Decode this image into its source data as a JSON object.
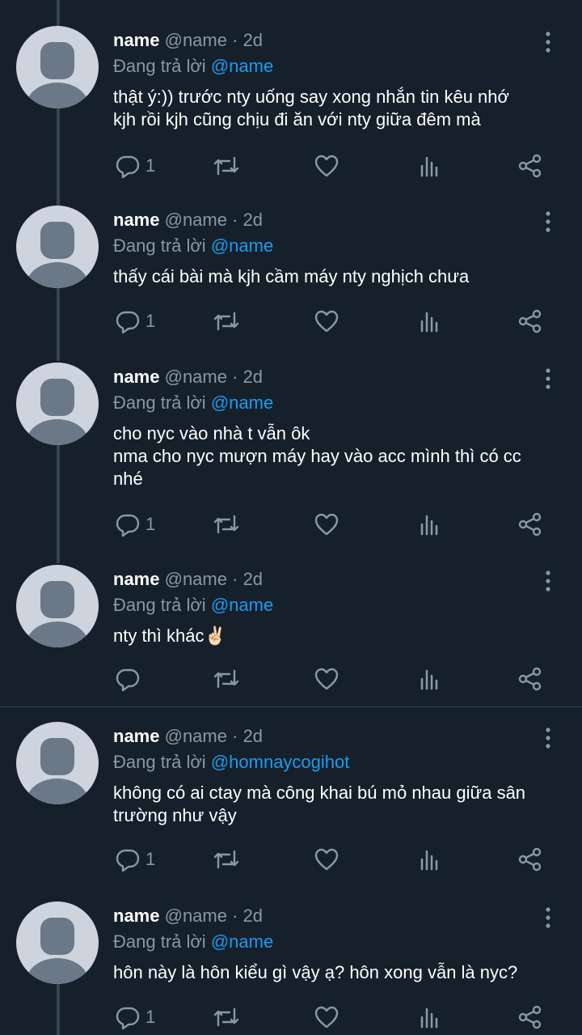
{
  "tweets": [
    {
      "name": "name",
      "handle": "@name",
      "sep": "·",
      "time": "2d",
      "reply_prefix": "Đang trả lời",
      "reply_to": "@name",
      "lines": [
        "thật ý:)) trước nty uống say xong nhắn tin kêu nhớ",
        "kjh rồi kjh cũng chịu đi ăn với nty giữa đêm mà"
      ],
      "reply_count": "1"
    },
    {
      "name": "name",
      "handle": "@name",
      "sep": "·",
      "time": "2d",
      "reply_prefix": "Đang trả lời",
      "reply_to": "@name",
      "lines": [
        "thấy cái bài mà kjh cầm máy nty nghịch chưa"
      ],
      "reply_count": "1"
    },
    {
      "name": "name",
      "handle": "@name",
      "sep": "·",
      "time": "2d",
      "reply_prefix": "Đang trả lời",
      "reply_to": "@name",
      "lines": [
        "cho nyc vào nhà t vẫn ôk",
        "nma cho nyc mượn máy hay vào acc mình thì có cc",
        "nhé"
      ],
      "reply_count": "1"
    },
    {
      "name": "name",
      "handle": "@name",
      "sep": "·",
      "time": "2d",
      "reply_prefix": "Đang trả lời",
      "reply_to": "@name",
      "lines": [
        "nty thì khác✌🏻"
      ],
      "reply_count": ""
    },
    {
      "name": "name",
      "handle": "@name",
      "sep": "·",
      "time": "2d",
      "reply_prefix": "Đang trả lời",
      "reply_to": "@homnaycogihot",
      "lines": [
        "không có ai ctay mà công khai bú mỏ nhau giữa sân",
        "trường như vậy"
      ],
      "reply_count": "1"
    },
    {
      "name": "name",
      "handle": "@name",
      "sep": "·",
      "time": "2d",
      "reply_prefix": "Đang trả lời",
      "reply_to": "@name",
      "lines": [
        "hôn này là hôn kiểu gì vậy ạ? hôn xong vẫn là nyc?"
      ],
      "reply_count": "1"
    }
  ],
  "icons": {
    "reply": "reply-icon",
    "retweet": "retweet-icon",
    "like": "heart-icon",
    "analytics": "analytics-icon",
    "share": "share-icon",
    "more": "more-vertical-icon"
  },
  "colors": {
    "background": "#15202b",
    "muted": "#8899a6",
    "link": "#1d9bf0",
    "avatar_bg": "#cdd4dd",
    "avatar_fg": "#6b7887"
  }
}
